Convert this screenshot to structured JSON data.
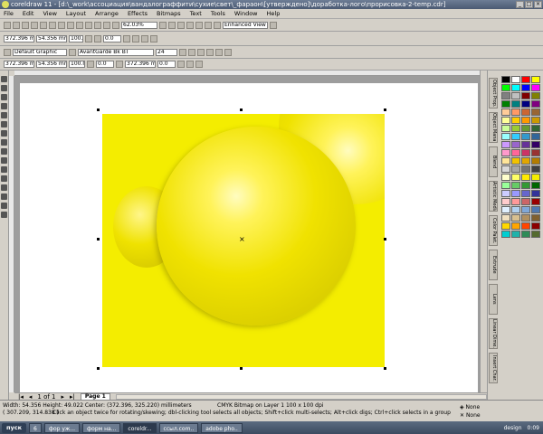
{
  "window": {
    "title": "coreldraw 11 - [d:\\_work\\ассоциация\\вандалограффити\\сухие\\свет\\_фараон\\[утверждено]\\доработка-лого\\прорисовка-2-temp.cdr]"
  },
  "menu": [
    "File",
    "Edit",
    "View",
    "Layout",
    "Arrange",
    "Effects",
    "Bitmaps",
    "Text",
    "Tools",
    "Window",
    "Help"
  ],
  "toolbar1": {
    "zoom": "62.03%",
    "view_mode": "Enhanced View"
  },
  "toolbar2": {
    "style": "Default Graphic",
    "font": "AvantGarde Bk BT",
    "size": "24"
  },
  "toolbar3": {
    "x": "372.396 mm",
    "y": "325.22 mm",
    "w": "54.356 mm",
    "h": "49.022 mm",
    "sx": "100.0",
    "sy": "100.0",
    "angle": "0.0",
    "x2": "372.396 mm",
    "y2": "325.22 mm",
    "v1": "0.0",
    "v2": "0.0"
  },
  "toolbar_upper": {
    "x": "372.396 mm",
    "y": "325.22 mm",
    "w": "54.356 mm",
    "h": "49.022 mm",
    "sx": "100.0",
    "sy": "100.0",
    "angle": "0.0"
  },
  "page_nav": {
    "count": "1 of 1",
    "tab": "Page 1"
  },
  "status": {
    "line1": "Width: 54.356  Height: 49.022  Center: (372.396, 325.220)  millimeters",
    "line1b": "CMYK Bitmap on Layer 1 100 x 100 dpi",
    "line2": "Click an object twice for rotating/skewing; dbl-clicking tool selects all objects; Shift+click multi-selects; Alt+click digs; Ctrl+click selects in a group",
    "coords": "( 307.209, 314.838 )",
    "fill": "None",
    "outline": "None"
  },
  "dockers": [
    "Object Prop.",
    "Object Mana.",
    "Blend",
    "Artistic Media",
    "Color Palet.",
    "Extrude",
    "Lens",
    "Linear Dime.",
    "Insert Char."
  ],
  "palette_colors": [
    "#000000",
    "#ffffff",
    "#ff0000",
    "#ffff00",
    "#00ff00",
    "#00ffff",
    "#0000ff",
    "#ff00ff",
    "#808080",
    "#c0c0c0",
    "#800000",
    "#808000",
    "#008000",
    "#008080",
    "#000080",
    "#800080",
    "#ffcc99",
    "#ff9966",
    "#cc6633",
    "#996633",
    "#ffff99",
    "#ffcc00",
    "#ff9900",
    "#cc9900",
    "#ccff99",
    "#99cc33",
    "#669933",
    "#336633",
    "#99ffff",
    "#33ccff",
    "#3399cc",
    "#336699",
    "#cc99ff",
    "#9966cc",
    "#663399",
    "#330066",
    "#ff99cc",
    "#ff6699",
    "#cc3366",
    "#993333",
    "#ffe599",
    "#f2c200",
    "#e2a600",
    "#b37c00",
    "#d9d9d9",
    "#a6a6a6",
    "#737373",
    "#404040",
    "#ffffcc",
    "#ffff66",
    "#ffeb00",
    "#f4ed00",
    "#99ff99",
    "#66cc66",
    "#339933",
    "#006600",
    "#ccccff",
    "#9999ff",
    "#6666cc",
    "#333399",
    "#ffcccc",
    "#ff9999",
    "#cc6666",
    "#990000",
    "#e0f0ff",
    "#b0d0f0",
    "#80a8d8",
    "#5078b0",
    "#f0e0c0",
    "#d8c090",
    "#b09060",
    "#806030",
    "#ffd700",
    "#ffa500",
    "#ff4500",
    "#8b0000",
    "#00ced1",
    "#20b2aa",
    "#2e8b57",
    "#556b2f"
  ],
  "taskbar": {
    "start": "пуск",
    "tasks": [
      "6",
      "фор уж...",
      "форм на...",
      "coreldr...",
      "ссыл.com..",
      "adobe pho.."
    ],
    "active_index": 3,
    "tray_label": "design",
    "clock": "0:09"
  }
}
